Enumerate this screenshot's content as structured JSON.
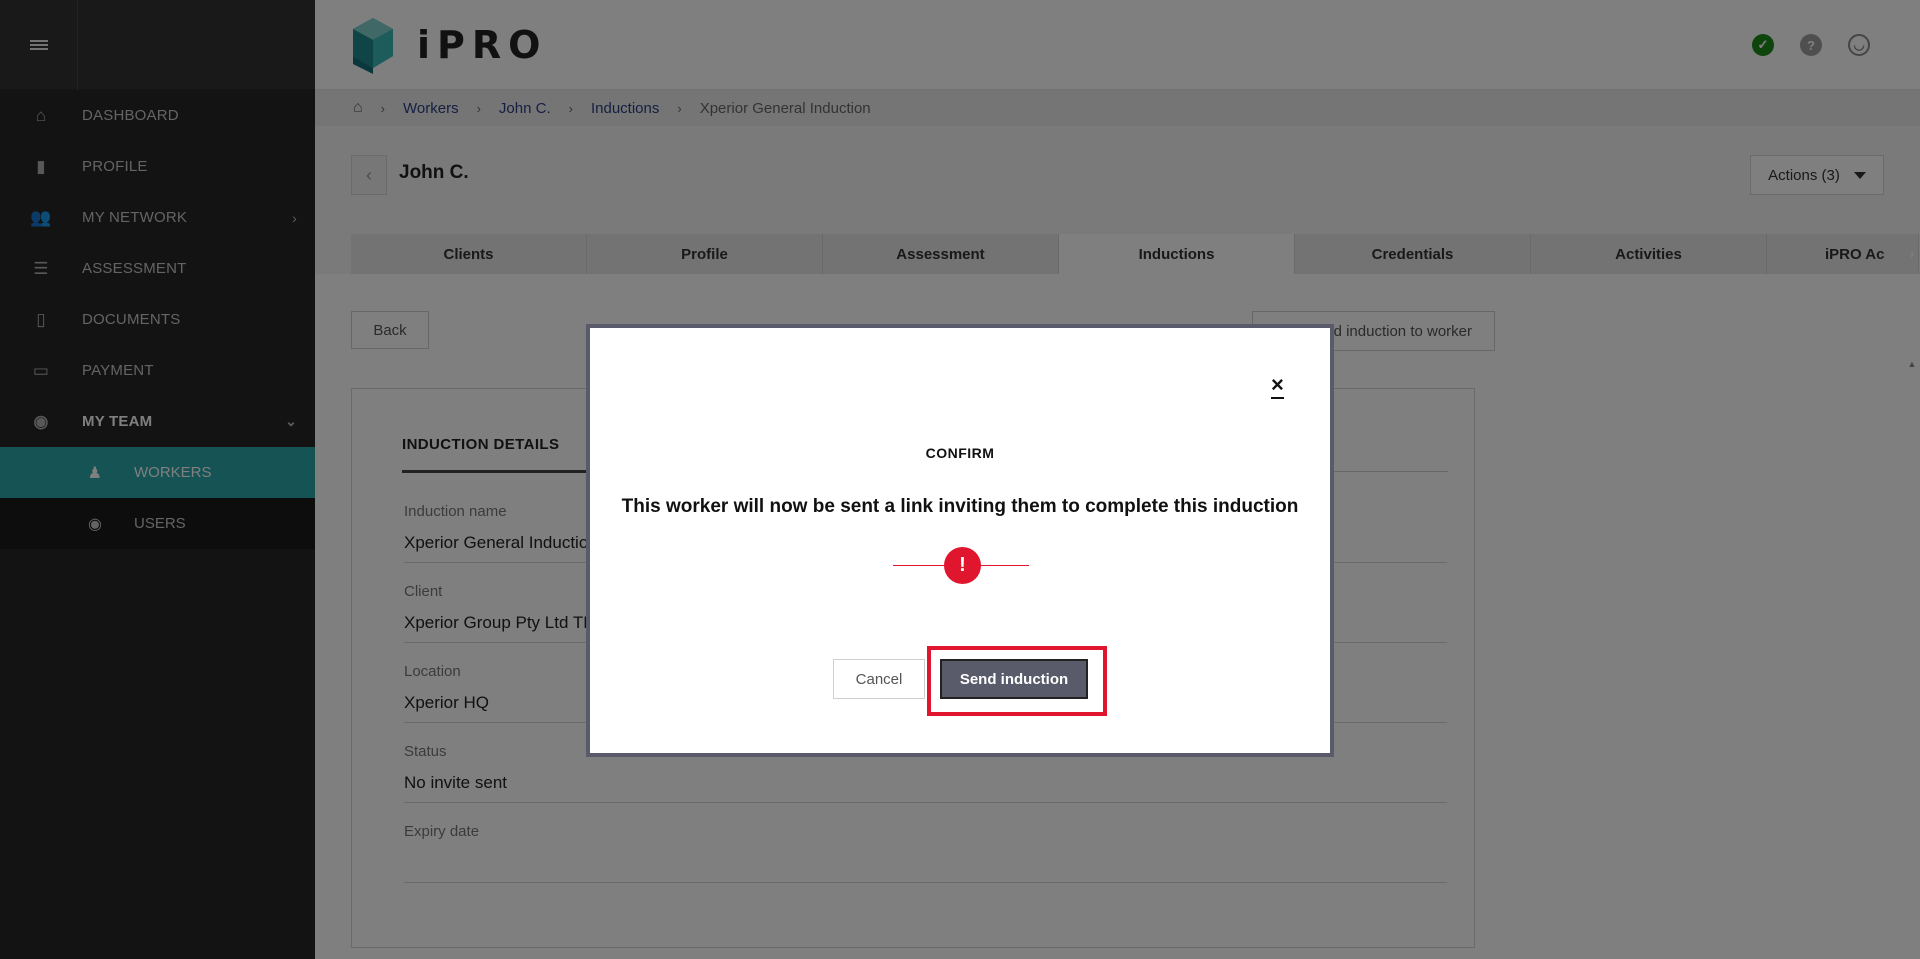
{
  "app": {
    "logo_text": "iPRO"
  },
  "sidebar": {
    "items": [
      {
        "label": "DASHBOARD",
        "icon": "home-icon"
      },
      {
        "label": "PROFILE",
        "icon": "building-icon"
      },
      {
        "label": "MY NETWORK",
        "icon": "users-icon"
      },
      {
        "label": "ASSESSMENT",
        "icon": "list-icon"
      },
      {
        "label": "DOCUMENTS",
        "icon": "document-icon"
      },
      {
        "label": "PAYMENT",
        "icon": "credit-card-icon"
      },
      {
        "label": "MY TEAM",
        "icon": "user-circle-icon"
      }
    ],
    "subitems": [
      {
        "label": "WORKERS",
        "icon": "person-icon"
      },
      {
        "label": "USERS",
        "icon": "user-circle-icon"
      }
    ]
  },
  "breadcrumb": [
    "Workers",
    "John C.",
    "Inductions",
    "Xperior General Induction"
  ],
  "header": {
    "name": "John C.",
    "actions_label": "Actions (3)"
  },
  "tabs": [
    "Clients",
    "Profile",
    "Assessment",
    "Inductions",
    "Credentials",
    "Activities",
    "iPRO Ac"
  ],
  "content": {
    "back_label": "Back",
    "send_label": "d induction to worker",
    "panel_title": "INDUCTION DETAILS",
    "fields": [
      {
        "label": "Induction name",
        "value": "Xperior General Inductio"
      },
      {
        "label": "Client",
        "value": "Xperior Group Pty Ltd TN"
      },
      {
        "label": "Location",
        "value": "Xperior HQ"
      },
      {
        "label": "Status",
        "value": "No invite sent"
      },
      {
        "label": "Expiry date",
        "value": ""
      }
    ]
  },
  "modal": {
    "close_label": "×",
    "title": "CONFIRM",
    "message": "This worker will now be sent a link inviting them to complete this induction",
    "alert_glyph": "!",
    "cancel_label": "Cancel",
    "confirm_label": "Send induction"
  },
  "colors": {
    "accent": "#2aa6a8",
    "danger": "#e0152e",
    "link": "#2a3f84",
    "sidebar": "#262626"
  }
}
